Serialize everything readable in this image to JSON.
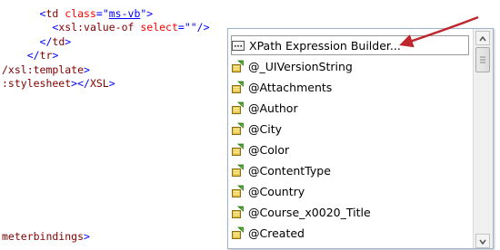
{
  "code_lines": [
    {
      "indent": "      ",
      "parts": [
        [
          "punc",
          "<"
        ],
        [
          "tag",
          "td "
        ],
        [
          "attr",
          "class"
        ],
        [
          "punc",
          "=\""
        ],
        [
          "val",
          "ms-vb"
        ],
        [
          "punc",
          "\">"
        ]
      ]
    },
    {
      "indent": "        ",
      "parts": [
        [
          "punc",
          "<"
        ],
        [
          "tag",
          "xsl:value-of "
        ],
        [
          "attr",
          "select"
        ],
        [
          "punc",
          "=\"\"/>"
        ]
      ]
    },
    {
      "indent": "      ",
      "parts": [
        [
          "punc",
          "</"
        ],
        [
          "tag",
          "td"
        ],
        [
          "punc",
          ">"
        ]
      ]
    },
    {
      "indent": "    ",
      "parts": [
        [
          "punc",
          "</"
        ],
        [
          "tag",
          "tr"
        ],
        [
          "punc",
          ">"
        ]
      ]
    },
    {
      "indent": "",
      "parts": [
        [
          "tag",
          "/xsl:template"
        ],
        [
          "punc",
          ">"
        ]
      ]
    },
    {
      "indent": "",
      "parts": [
        [
          "tag",
          ":stylesheet"
        ],
        [
          "punc",
          "></"
        ],
        [
          "tag",
          "XSL"
        ],
        [
          "punc",
          ">"
        ]
      ]
    }
  ],
  "bottom_line": {
    "parts": [
      [
        "tag",
        "meterbindings"
      ],
      [
        "punc",
        ">"
      ]
    ]
  },
  "intellisense": {
    "items": [
      {
        "label": "XPath Expression Builder...",
        "icon": "ellipsis-icon",
        "selected": true
      },
      {
        "label": "@_UIVersionString",
        "icon": "field-icon"
      },
      {
        "label": "@Attachments",
        "icon": "field-icon"
      },
      {
        "label": "@Author",
        "icon": "field-icon"
      },
      {
        "label": "@City",
        "icon": "field-icon"
      },
      {
        "label": "@Color",
        "icon": "field-icon"
      },
      {
        "label": "@ContentType",
        "icon": "field-icon"
      },
      {
        "label": "@Country",
        "icon": "field-icon"
      },
      {
        "label": "@Course_x0020_Title",
        "icon": "field-icon"
      },
      {
        "label": "@Created",
        "icon": "field-icon"
      }
    ]
  },
  "annotation": {
    "color": "#c0272d"
  }
}
